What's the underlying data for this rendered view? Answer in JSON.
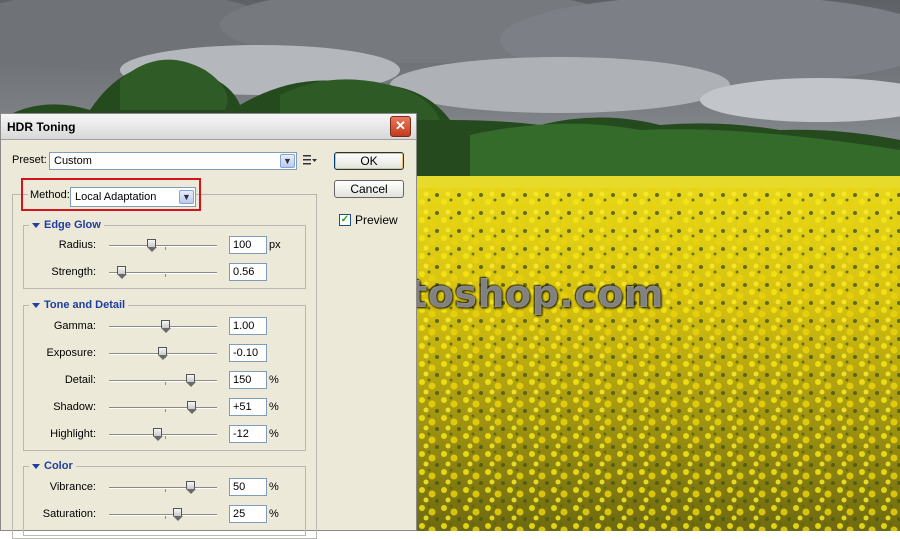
{
  "watermark": "SoloPhotoshop.com",
  "dialog": {
    "title": "HDR Toning",
    "close_glyph": "✕",
    "preset_label": "Preset:",
    "preset_value": "Custom",
    "method_label": "Method:",
    "method_value": "Local Adaptation",
    "ok_label": "OK",
    "cancel_label": "Cancel",
    "preview_label": "Preview",
    "preview_checked": true,
    "sections": {
      "edge_glow": {
        "title": "Edge Glow",
        "rows": [
          {
            "label": "Radius:",
            "value": "100",
            "unit": "px",
            "slider": 0.4
          },
          {
            "label": "Strength:",
            "value": "0.56",
            "unit": "",
            "slider": 0.12
          }
        ]
      },
      "tone_detail": {
        "title": "Tone and Detail",
        "rows": [
          {
            "label": "Gamma:",
            "value": "1.00",
            "unit": "",
            "slider": 0.53
          },
          {
            "label": "Exposure:",
            "value": "-0.10",
            "unit": "",
            "slider": 0.5
          },
          {
            "label": "Detail:",
            "value": "150",
            "unit": "%",
            "slider": 0.76
          },
          {
            "label": "Shadow:",
            "value": "+51",
            "unit": "%",
            "slider": 0.77
          },
          {
            "label": "Highlight:",
            "value": "-12",
            "unit": "%",
            "slider": 0.45
          }
        ]
      },
      "color": {
        "title": "Color",
        "rows": [
          {
            "label": "Vibrance:",
            "value": "50",
            "unit": "%",
            "slider": 0.76
          },
          {
            "label": "Saturation:",
            "value": "25",
            "unit": "%",
            "slider": 0.64
          }
        ]
      }
    }
  },
  "colors": {
    "highlight_box": "#d4141a",
    "section_title": "#1f3e9e",
    "dialog_bg": "#ece9d8"
  }
}
